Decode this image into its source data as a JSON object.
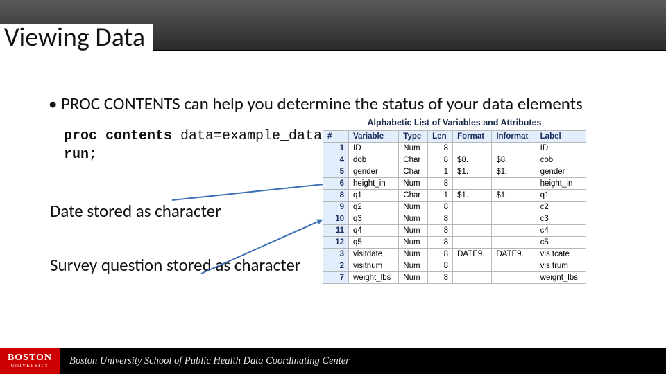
{
  "title": "Viewing Data",
  "bullet": "PROC CONTENTS can help you determine the status of your data elements",
  "code": {
    "line1_b": "proc contents ",
    "line1_r": "data=example_data;",
    "line2_b": "run",
    "line2_r": ";"
  },
  "note1": "Date stored as character",
  "note2": "Survey question stored as character",
  "table_title": "Alphabetic List of Variables and Attributes",
  "headers": [
    "#",
    "Variable",
    "Type",
    "Len",
    "Format",
    "Informat",
    "Label"
  ],
  "rows": [
    {
      "n": "1",
      "var": "ID",
      "type": "Num",
      "len": "8",
      "fmt": "",
      "inf": "",
      "lbl": "ID"
    },
    {
      "n": "4",
      "var": "dob",
      "type": "Char",
      "len": "8",
      "fmt": "$8.",
      "inf": "$8.",
      "lbl": "cob"
    },
    {
      "n": "5",
      "var": "gender",
      "type": "Char",
      "len": "1",
      "fmt": "$1.",
      "inf": "$1.",
      "lbl": "gender"
    },
    {
      "n": "6",
      "var": "height_in",
      "type": "Num",
      "len": "8",
      "fmt": "",
      "inf": "",
      "lbl": "height_in"
    },
    {
      "n": "8",
      "var": "q1",
      "type": "Char",
      "len": "1",
      "fmt": "$1.",
      "inf": "$1.",
      "lbl": "q1"
    },
    {
      "n": "9",
      "var": "q2",
      "type": "Num",
      "len": "8",
      "fmt": "",
      "inf": "",
      "lbl": "c2"
    },
    {
      "n": "10",
      "var": "q3",
      "type": "Num",
      "len": "8",
      "fmt": "",
      "inf": "",
      "lbl": "c3"
    },
    {
      "n": "11",
      "var": "q4",
      "type": "Num",
      "len": "8",
      "fmt": "",
      "inf": "",
      "lbl": "c4"
    },
    {
      "n": "12",
      "var": "q5",
      "type": "Num",
      "len": "8",
      "fmt": "",
      "inf": "",
      "lbl": "c5"
    },
    {
      "n": "3",
      "var": "visitdate",
      "type": "Num",
      "len": "8",
      "fmt": "DATE9.",
      "inf": "DATE9.",
      "lbl": "vis tcate"
    },
    {
      "n": "2",
      "var": "visitnum",
      "type": "Num",
      "len": "8",
      "fmt": "",
      "inf": "",
      "lbl": "vis trum"
    },
    {
      "n": "7",
      "var": "weight_lbs",
      "type": "Num",
      "len": "8",
      "fmt": "",
      "inf": "",
      "lbl": "weignt_lbs"
    }
  ],
  "footer": {
    "logo_top": "BOSTON",
    "logo_bottom": "UNIVERSITY",
    "text": "Boston University School of Public Health Data Coordinating Center"
  }
}
